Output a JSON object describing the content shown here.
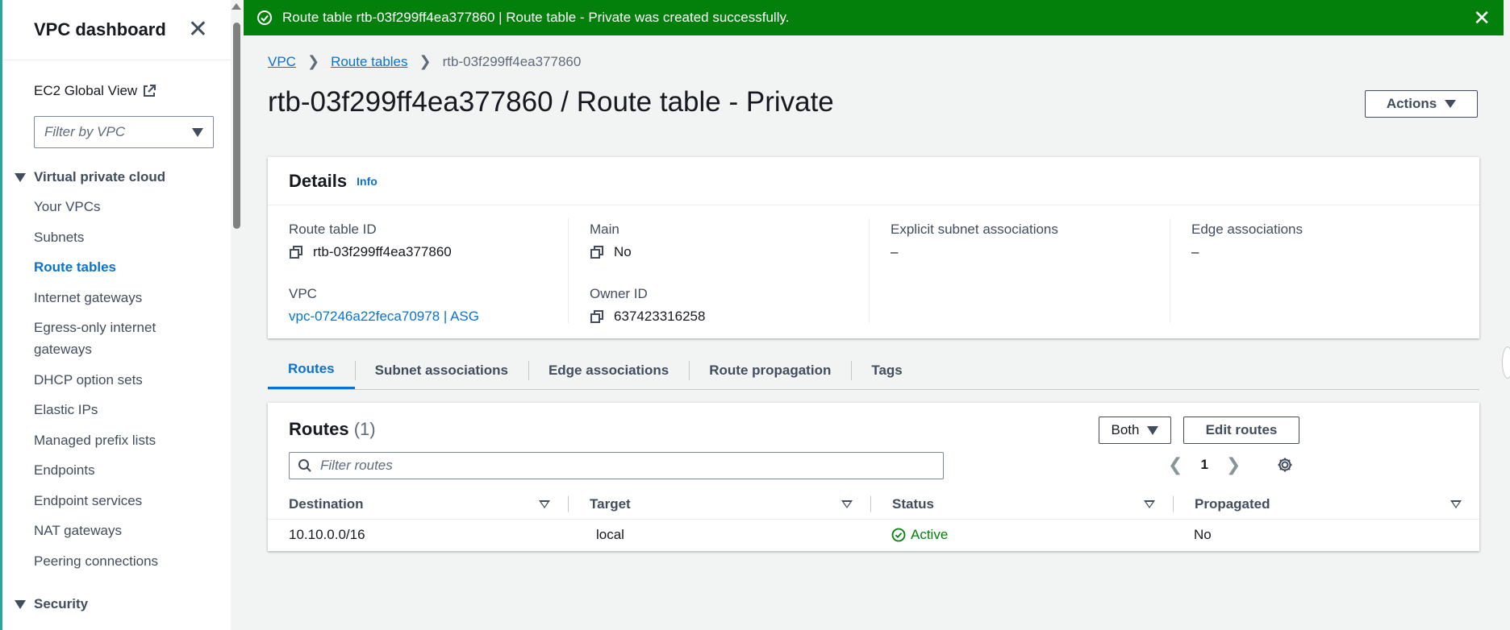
{
  "sidebar": {
    "title": "VPC dashboard",
    "global_view": "EC2 Global View",
    "filter_placeholder": "Filter by VPC",
    "section_vpc": "Virtual private cloud",
    "items": [
      {
        "label": "Your VPCs"
      },
      {
        "label": "Subnets"
      },
      {
        "label": "Route tables",
        "active": true
      },
      {
        "label": "Internet gateways"
      },
      {
        "label": "Egress-only internet gateways"
      },
      {
        "label": "DHCP option sets"
      },
      {
        "label": "Elastic IPs"
      },
      {
        "label": "Managed prefix lists"
      },
      {
        "label": "Endpoints"
      },
      {
        "label": "Endpoint services"
      },
      {
        "label": "NAT gateways"
      },
      {
        "label": "Peering connections"
      }
    ],
    "section_security": "Security"
  },
  "banner": {
    "message": "Route table rtb-03f299ff4ea377860 | Route table - Private was created successfully.",
    "color": "#037f0c"
  },
  "breadcrumb": {
    "vpc": "VPC",
    "route_tables": "Route tables",
    "current": "rtb-03f299ff4ea377860"
  },
  "page": {
    "title": "rtb-03f299ff4ea377860 / Route table - Private",
    "actions_label": "Actions"
  },
  "details": {
    "heading": "Details",
    "info": "Info",
    "route_table_id_label": "Route table ID",
    "route_table_id": "rtb-03f299ff4ea377860",
    "main_label": "Main",
    "main": "No",
    "explicit_label": "Explicit subnet associations",
    "explicit": "–",
    "edge_label": "Edge associations",
    "edge": "–",
    "vpc_label": "VPC",
    "vpc": "vpc-07246a22feca70978 | ASG",
    "owner_label": "Owner ID",
    "owner": "637423316258"
  },
  "tabs": [
    {
      "label": "Routes",
      "active": true
    },
    {
      "label": "Subnet associations"
    },
    {
      "label": "Edge associations"
    },
    {
      "label": "Route propagation"
    },
    {
      "label": "Tags"
    }
  ],
  "routes": {
    "title": "Routes",
    "count": "(1)",
    "both_label": "Both",
    "edit_label": "Edit routes",
    "filter_placeholder": "Filter routes",
    "page": "1",
    "columns": [
      "Destination",
      "Target",
      "Status",
      "Propagated"
    ],
    "rows": [
      {
        "destination": "10.10.0.0/16",
        "target": "local",
        "status": "Active",
        "propagated": "No"
      }
    ]
  }
}
